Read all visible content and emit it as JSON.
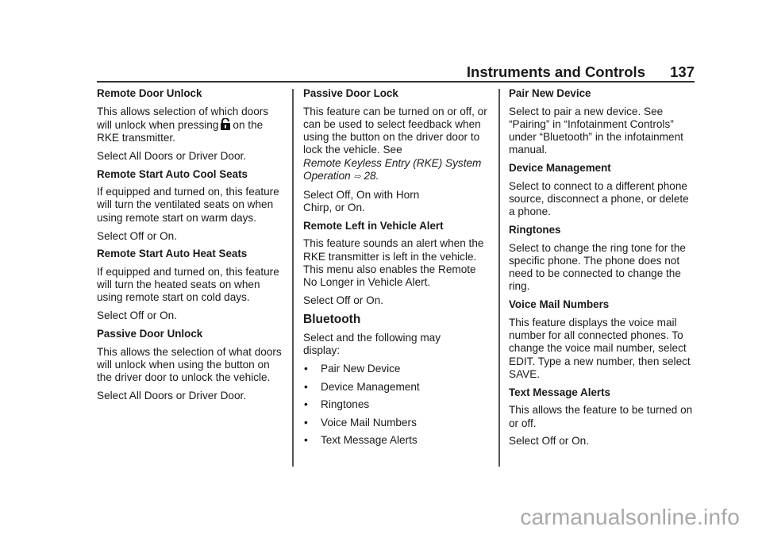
{
  "header": {
    "title": "Instruments and Controls",
    "page_number": "137"
  },
  "columns": {
    "col1": {
      "remote_door_unlock": {
        "heading": "Remote Door Unlock",
        "text_before_icon": "This allows selection of which doors will unlock when pressing",
        "icon": "unlock-icon",
        "text_after_icon": "on the RKE transmitter.",
        "select": "Select All Doors or Driver Door."
      },
      "remote_start_cool": {
        "heading": "Remote Start Auto Cool Seats",
        "text": "If equipped and turned on, this feature will turn the ventilated seats on when using remote start on warm days.",
        "select": "Select Off or On."
      },
      "remote_start_heat": {
        "heading": "Remote Start Auto Heat Seats",
        "text": "If equipped and turned on, this feature will turn the heated seats on when using remote start on cold days.",
        "select": "Select Off or On."
      },
      "passive_door_unlock": {
        "heading": "Passive Door Unlock",
        "text": "This allows the selection of what doors will unlock when using the button on the driver door to unlock the vehicle.",
        "select": "Select All Doors or Driver Door."
      }
    },
    "col2": {
      "passive_door_lock": {
        "heading": "Passive Door Lock",
        "text": "This feature can be turned on or off, or can be used to select feedback when using the button on the driver door to lock the vehicle. See",
        "ref_italic": "Remote Keyless Entry (RKE) System Operation",
        "ref_icon": "arrow-icon",
        "ref_arrow": "⇨",
        "ref_page": "28",
        "ref_end": ".",
        "select": "Select Off, On with Horn Chirp, or On."
      },
      "remote_left_alert": {
        "heading": "Remote Left in Vehicle Alert",
        "text": "This feature sounds an alert when the RKE transmitter is left in the vehicle. This menu also enables the Remote No Longer in Vehicle Alert.",
        "select": "Select Off or On."
      },
      "bluetooth": {
        "heading": "Bluetooth",
        "intro": "Select and the following may display:",
        "bullet": "•",
        "items": [
          "Pair New Device",
          "Device Management",
          "Ringtones",
          "Voice Mail Numbers",
          "Text Message Alerts"
        ]
      }
    },
    "col3": {
      "pair_new_device": {
        "heading": "Pair New Device",
        "text": "Select to pair a new device. See “Pairing” in “Infotainment Controls” under “Bluetooth” in the infotainment manual."
      },
      "device_management": {
        "heading": "Device Management",
        "text": "Select to connect to a different phone source, disconnect a phone, or delete a phone."
      },
      "ringtones": {
        "heading": "Ringtones",
        "text": "Select to change the ring tone for the specific phone. The phone does not need to be connected to change the ring."
      },
      "voice_mail_numbers": {
        "heading": "Voice Mail Numbers",
        "text": "This feature displays the voice mail number for all connected phones. To change the voice mail number, select EDIT. Type a new number, then select SAVE."
      },
      "text_message_alerts": {
        "heading": "Text Message Alerts",
        "text": "This allows the feature to be turned on or off.",
        "select": "Select Off or On."
      }
    }
  },
  "watermark": "carmanualsonline.info"
}
